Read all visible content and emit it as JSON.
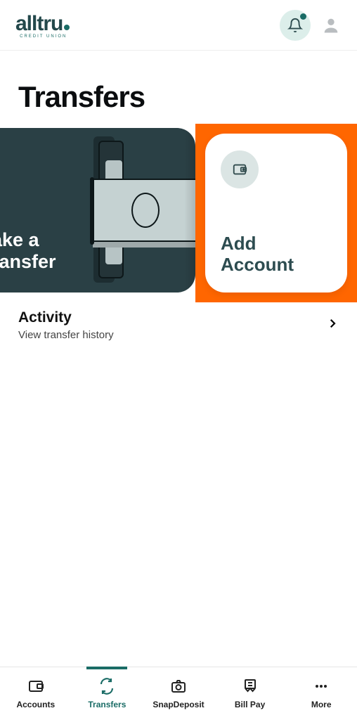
{
  "brand": {
    "name": "alltru",
    "sub": "CREDIT UNION"
  },
  "page": {
    "title": "Transfers"
  },
  "cards": {
    "transfer": {
      "line1": "ake a",
      "line2": "ransfer"
    },
    "add": {
      "title": "Add Account"
    }
  },
  "activity": {
    "title": "Activity",
    "subtitle": "View transfer history"
  },
  "nav": {
    "accounts": "Accounts",
    "transfers": "Transfers",
    "snapdeposit": "SnapDeposit",
    "billpay": "Bill Pay",
    "more": "More"
  }
}
